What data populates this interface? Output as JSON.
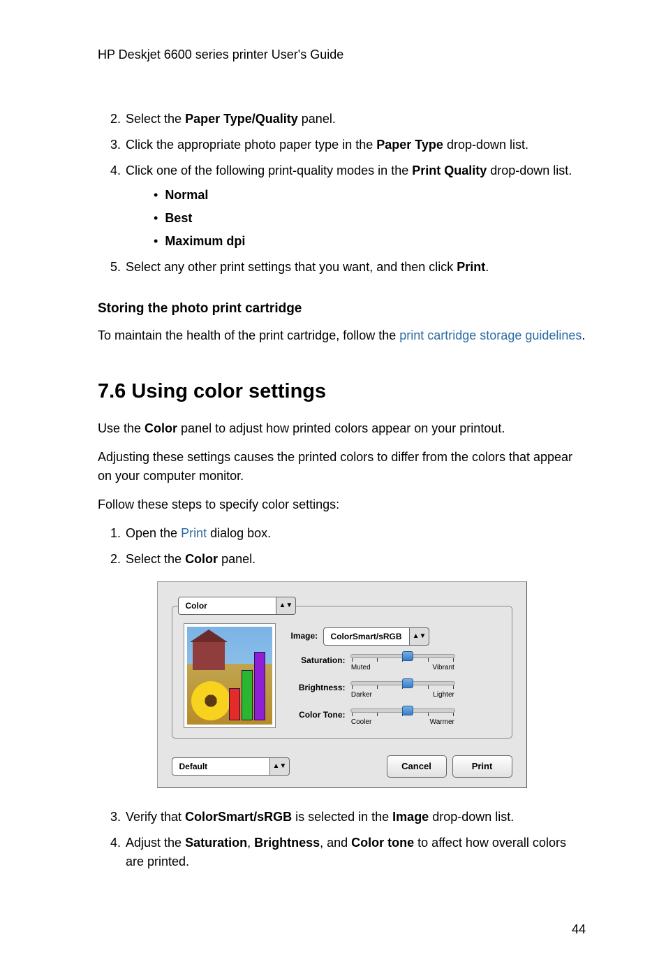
{
  "header": "HP Deskjet 6600 series printer User's Guide",
  "list1": {
    "n2": "2.",
    "t2a": "Select the ",
    "t2b": "Paper Type/Quality",
    "t2c": " panel.",
    "n3": "3.",
    "t3a": "Click the appropriate photo paper type in the ",
    "t3b": "Paper Type",
    "t3c": " drop-down list.",
    "n4": "4.",
    "t4a": "Click one of the following print-quality modes in the ",
    "t4b": "Print Quality",
    "t4c": " drop-down list.",
    "b1": "Normal",
    "b2": "Best",
    "b3": "Maximum dpi",
    "n5": "5.",
    "t5a": "Select any other print settings that you want, and then click ",
    "t5b": "Print",
    "t5c": "."
  },
  "subhead": "Storing the photo print cartridge",
  "storing_p1": "To maintain the health of the print cartridge, follow the ",
  "storing_link": "print cartridge storage guidelines",
  "storing_p2": ".",
  "section": "7.6  Using color settings",
  "p1a": "Use the ",
  "p1b": "Color",
  "p1c": " panel to adjust how printed colors appear on your printout.",
  "p2": "Adjusting these settings causes the printed colors to differ from the colors that appear on your computer monitor.",
  "p3": "Follow these steps to specify color settings:",
  "list2": {
    "n1": "1.",
    "t1a": "Open the ",
    "t1link": "Print",
    "t1b": " dialog box.",
    "n2": "2.",
    "t2a": "Select the ",
    "t2b": "Color",
    "t2c": " panel.",
    "n3": "3.",
    "t3a": "Verify that ",
    "t3b": "ColorSmart/sRGB",
    "t3c": " is selected in the ",
    "t3d": "Image",
    "t3e": " drop-down list.",
    "n4": "4.",
    "t4a": "Adjust the ",
    "t4b": "Saturation",
    "t4c": ", ",
    "t4d": "Brightness",
    "t4e": ", and ",
    "t4f": "Color tone",
    "t4g": " to affect how overall colors are printed."
  },
  "dialog": {
    "panel_select": "Color",
    "image_label": "Image:",
    "image_value": "ColorSmart/sRGB",
    "sliders": {
      "sat": {
        "label": "Saturation:",
        "left": "Muted",
        "right": "Vibrant"
      },
      "bri": {
        "label": "Brightness:",
        "left": "Darker",
        "right": "Lighter"
      },
      "tone": {
        "label": "Color Tone:",
        "left": "Cooler",
        "right": "Warmer"
      }
    },
    "preset": "Default",
    "cancel": "Cancel",
    "print": "Print"
  },
  "page_num": "44"
}
